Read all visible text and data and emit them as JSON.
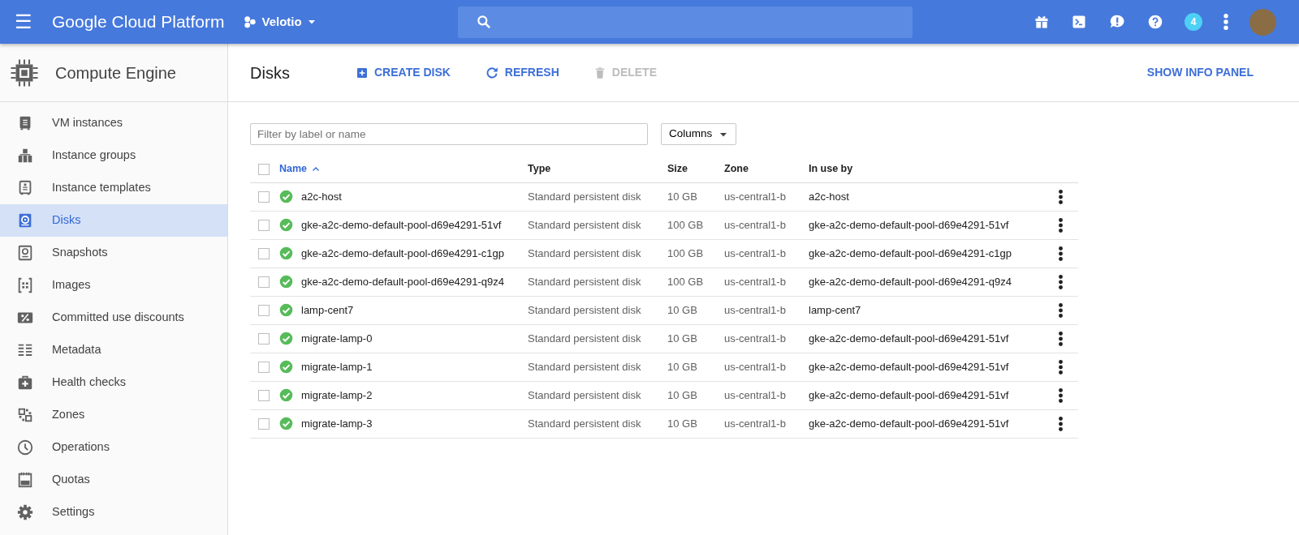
{
  "header": {
    "menu_label": "☰",
    "product": "Google Cloud Platform",
    "project": "Velotio",
    "notification_count": "4"
  },
  "sidebar": {
    "title": "Compute Engine",
    "items": [
      {
        "label": "VM instances",
        "selected": false
      },
      {
        "label": "Instance groups",
        "selected": false
      },
      {
        "label": "Instance templates",
        "selected": false
      },
      {
        "label": "Disks",
        "selected": true
      },
      {
        "label": "Snapshots",
        "selected": false
      },
      {
        "label": "Images",
        "selected": false
      },
      {
        "label": "Committed use discounts",
        "selected": false
      },
      {
        "label": "Metadata",
        "selected": false
      },
      {
        "label": "Health checks",
        "selected": false
      },
      {
        "label": "Zones",
        "selected": false
      },
      {
        "label": "Operations",
        "selected": false
      },
      {
        "label": "Quotas",
        "selected": false
      },
      {
        "label": "Settings",
        "selected": false
      }
    ]
  },
  "toolbar": {
    "title": "Disks",
    "actions": [
      {
        "kind": "create",
        "label": "CREATE DISK",
        "disabled": false
      },
      {
        "kind": "refresh",
        "label": "REFRESH",
        "disabled": false
      },
      {
        "kind": "delete",
        "label": "DELETE",
        "disabled": true
      }
    ],
    "info_panel": "SHOW INFO PANEL"
  },
  "filter": {
    "placeholder": "Filter by label or name"
  },
  "columns_button": "Columns",
  "table": {
    "all_checked": false,
    "columns": [
      {
        "label": "Name",
        "sorted": true
      },
      {
        "label": "Type",
        "sorted": false
      },
      {
        "label": "Size",
        "sorted": false
      },
      {
        "label": "Zone",
        "sorted": false
      },
      {
        "label": "In use by",
        "sorted": false
      }
    ],
    "rows": [
      {
        "checked": false,
        "name": "a2c-host",
        "type": "Standard persistent disk",
        "size": "10 GB",
        "zone": "us-central1-b",
        "in_use_by": "a2c-host"
      },
      {
        "checked": false,
        "name": "gke-a2c-demo-default-pool-d69e4291-51vf",
        "type": "Standard persistent disk",
        "size": "100 GB",
        "zone": "us-central1-b",
        "in_use_by": "gke-a2c-demo-default-pool-d69e4291-51vf"
      },
      {
        "checked": false,
        "name": "gke-a2c-demo-default-pool-d69e4291-c1gp",
        "type": "Standard persistent disk",
        "size": "100 GB",
        "zone": "us-central1-b",
        "in_use_by": "gke-a2c-demo-default-pool-d69e4291-c1gp"
      },
      {
        "checked": false,
        "name": "gke-a2c-demo-default-pool-d69e4291-q9z4",
        "type": "Standard persistent disk",
        "size": "100 GB",
        "zone": "us-central1-b",
        "in_use_by": "gke-a2c-demo-default-pool-d69e4291-q9z4"
      },
      {
        "checked": false,
        "name": "lamp-cent7",
        "type": "Standard persistent disk",
        "size": "10 GB",
        "zone": "us-central1-b",
        "in_use_by": "lamp-cent7"
      },
      {
        "checked": false,
        "name": "migrate-lamp-0",
        "type": "Standard persistent disk",
        "size": "10 GB",
        "zone": "us-central1-b",
        "in_use_by": "gke-a2c-demo-default-pool-d69e4291-51vf"
      },
      {
        "checked": false,
        "name": "migrate-lamp-1",
        "type": "Standard persistent disk",
        "size": "10 GB",
        "zone": "us-central1-b",
        "in_use_by": "gke-a2c-demo-default-pool-d69e4291-51vf"
      },
      {
        "checked": false,
        "name": "migrate-lamp-2",
        "type": "Standard persistent disk",
        "size": "10 GB",
        "zone": "us-central1-b",
        "in_use_by": "gke-a2c-demo-default-pool-d69e4291-51vf"
      },
      {
        "checked": false,
        "name": "migrate-lamp-3",
        "type": "Standard persistent disk",
        "size": "10 GB",
        "zone": "us-central1-b",
        "in_use_by": "gke-a2c-demo-default-pool-d69e4291-51vf"
      }
    ]
  }
}
